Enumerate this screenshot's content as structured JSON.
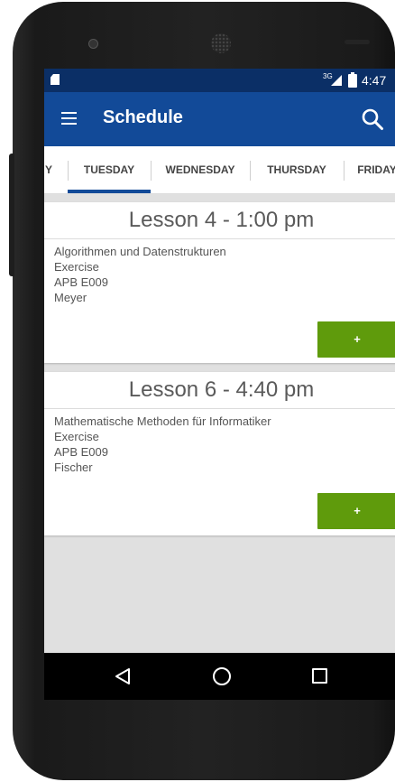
{
  "status_bar": {
    "network": "3G",
    "time": "4:47"
  },
  "app_bar": {
    "title": "Schedule"
  },
  "tabs": [
    {
      "label": "Y"
    },
    {
      "label": "TUESDAY",
      "selected": true
    },
    {
      "label": "WEDNESDAY"
    },
    {
      "label": "THURSDAY"
    },
    {
      "label": "FRIDAY"
    }
  ],
  "lessons": [
    {
      "header": "Lesson 4 - 1:00 pm",
      "course": "Algorithmen und Datenstrukturen",
      "type": "Exercise",
      "room": "APB E009",
      "teacher": "Meyer",
      "button_label": "+"
    },
    {
      "header": "Lesson 6 - 4:40 pm",
      "course": "Mathematische Methoden für Informatiker",
      "type": "Exercise",
      "room": "APB E009",
      "teacher": "Fischer",
      "button_label": "+"
    }
  ],
  "colors": {
    "status_bar": "#0b2f66",
    "app_bar": "#124a98",
    "accent_button": "#5f9b0c",
    "tab_indicator": "#124a98"
  }
}
